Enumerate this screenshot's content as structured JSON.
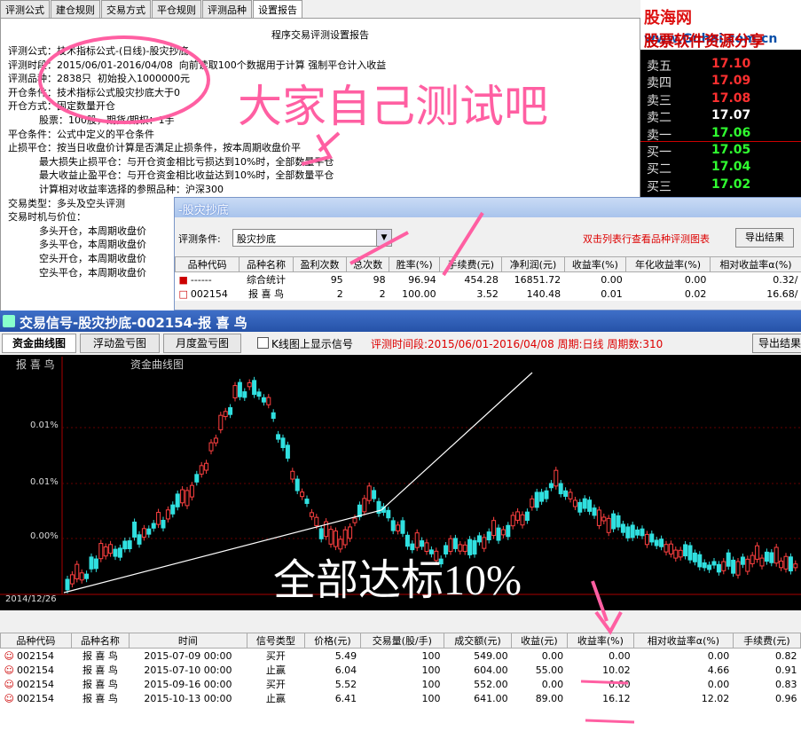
{
  "tabs": [
    "评测公式",
    "建仓规则",
    "交易方式",
    "平仓规则",
    "评测品种",
    "设置报告"
  ],
  "report": {
    "title": "程序交易评测设置报告",
    "lines": [
      "评测公式：技术指标公式-(日线)-股灾抄底",
      "评测时段：2015/06/01-2016/04/08  向前读取100个数据用于计算 强制平仓计入收益",
      "评测品种：2838只  初始投入1000000元",
      "开仓条件：技术指标公式股灾抄底大于0",
      "开仓方式：固定数量开仓",
      "          股票：100股，期货/期权：1手",
      "平仓条件：公式中定义的平仓条件",
      "止损平仓：按当日收盘价计算是否满足止损条件，按本周期收盘价平",
      "          最大损失止损平仓：与开仓资金相比亏损达到10%时，全部数量平仓",
      "          最大收益止盈平仓：与开仓资金相比收益达到10%时，全部数量平仓",
      "          计算相对收益率选择的参照品种：沪深300",
      "",
      "交易类型：多头及空头评测",
      "交易时机与价位：",
      "          多头开仓，本周期收盘价",
      "          多头平仓，本周期收盘价",
      "          空头开仓，本周期收盘价",
      "          空头平仓，本周期收盘价"
    ]
  },
  "brand": {
    "name1": "股海网",
    "name2": "股票软件资源分享",
    "url": "www.Guhai.com.cn"
  },
  "quote": [
    {
      "label": "卖五",
      "value": "17.10",
      "color": "#ff3030"
    },
    {
      "label": "卖四",
      "value": "17.09",
      "color": "#ff3030"
    },
    {
      "label": "卖三",
      "value": "17.08",
      "color": "#ff3030"
    },
    {
      "label": "卖二",
      "value": "17.07",
      "color": "#ffffff"
    },
    {
      "label": "卖一",
      "value": "17.06",
      "color": "#30ff30"
    },
    {
      "label": "买一",
      "value": "17.05",
      "color": "#30ff30"
    },
    {
      "label": "买二",
      "value": "17.04",
      "color": "#30ff30"
    },
    {
      "label": "买三",
      "value": "17.02",
      "color": "#30ff30"
    }
  ],
  "dialog": {
    "title": "-股灾抄底",
    "cond_label": "评测条件:",
    "cond_value": "股灾抄底",
    "hint": "双击列表行查看品种评测图表",
    "export": "导出结果",
    "headers": [
      "品种代码",
      "品种名称",
      "盈利次数",
      "总次数",
      "胜率(%)",
      "手续费(元)",
      "净利润(元)",
      "收益率(%)",
      "年化收益率(%)",
      "相对收益率α(%)"
    ],
    "rows": [
      [
        "------",
        "综合统计",
        "95",
        "98",
        "96.94",
        "454.28",
        "16851.72",
        "0.00",
        "0.00",
        "0.32/"
      ],
      [
        "002154",
        "报 喜 鸟",
        "2",
        "2",
        "100.00",
        "3.52",
        "140.48",
        "0.01",
        "0.02",
        "16.68/"
      ]
    ]
  },
  "trade": {
    "title": "交易信号-股灾抄底-002154-报 喜 鸟",
    "tabs": [
      "资金曲线图",
      "浮动盈亏图",
      "月度盈亏图"
    ],
    "checkbox": "K线图上显示信号",
    "info": "评测时间段:2015/06/01-2016/04/08  周期:日线  周期数:310",
    "export": "导出结果",
    "chart_labels": {
      "left": "报 喜 鸟",
      "right": "资金曲线图",
      "date": "2014/12/26"
    },
    "y_ticks": [
      "0.01%",
      "0.01%",
      "0.00%"
    ]
  },
  "bottom": {
    "headers": [
      "品种代码",
      "品种名称",
      "时间",
      "信号类型",
      "价格(元)",
      "交易量(股/手)",
      "成交额(元)",
      "收益(元)",
      "收益率(%)",
      "相对收益率α(%)",
      "手续费(元)"
    ],
    "rows": [
      [
        "002154",
        "报 喜 鸟",
        "2015-07-09 00:00",
        "买开",
        "5.49",
        "100",
        "549.00",
        "0.00",
        "0.00",
        "0.00",
        "0.82"
      ],
      [
        "002154",
        "报 喜 鸟",
        "2015-07-10 00:00",
        "止赢",
        "6.04",
        "100",
        "604.00",
        "55.00",
        "10.02",
        "4.66",
        "0.91"
      ],
      [
        "002154",
        "报 喜 鸟",
        "2015-09-16 00:00",
        "买开",
        "5.52",
        "100",
        "552.00",
        "0.00",
        "0.00",
        "0.00",
        "0.83"
      ],
      [
        "002154",
        "报 喜 鸟",
        "2015-10-13 00:00",
        "止赢",
        "6.41",
        "100",
        "641.00",
        "89.00",
        "16.12",
        "12.02",
        "0.96"
      ]
    ]
  },
  "annotations": {
    "top": "大家自己测试吧",
    "middle": "全部达标10%"
  }
}
